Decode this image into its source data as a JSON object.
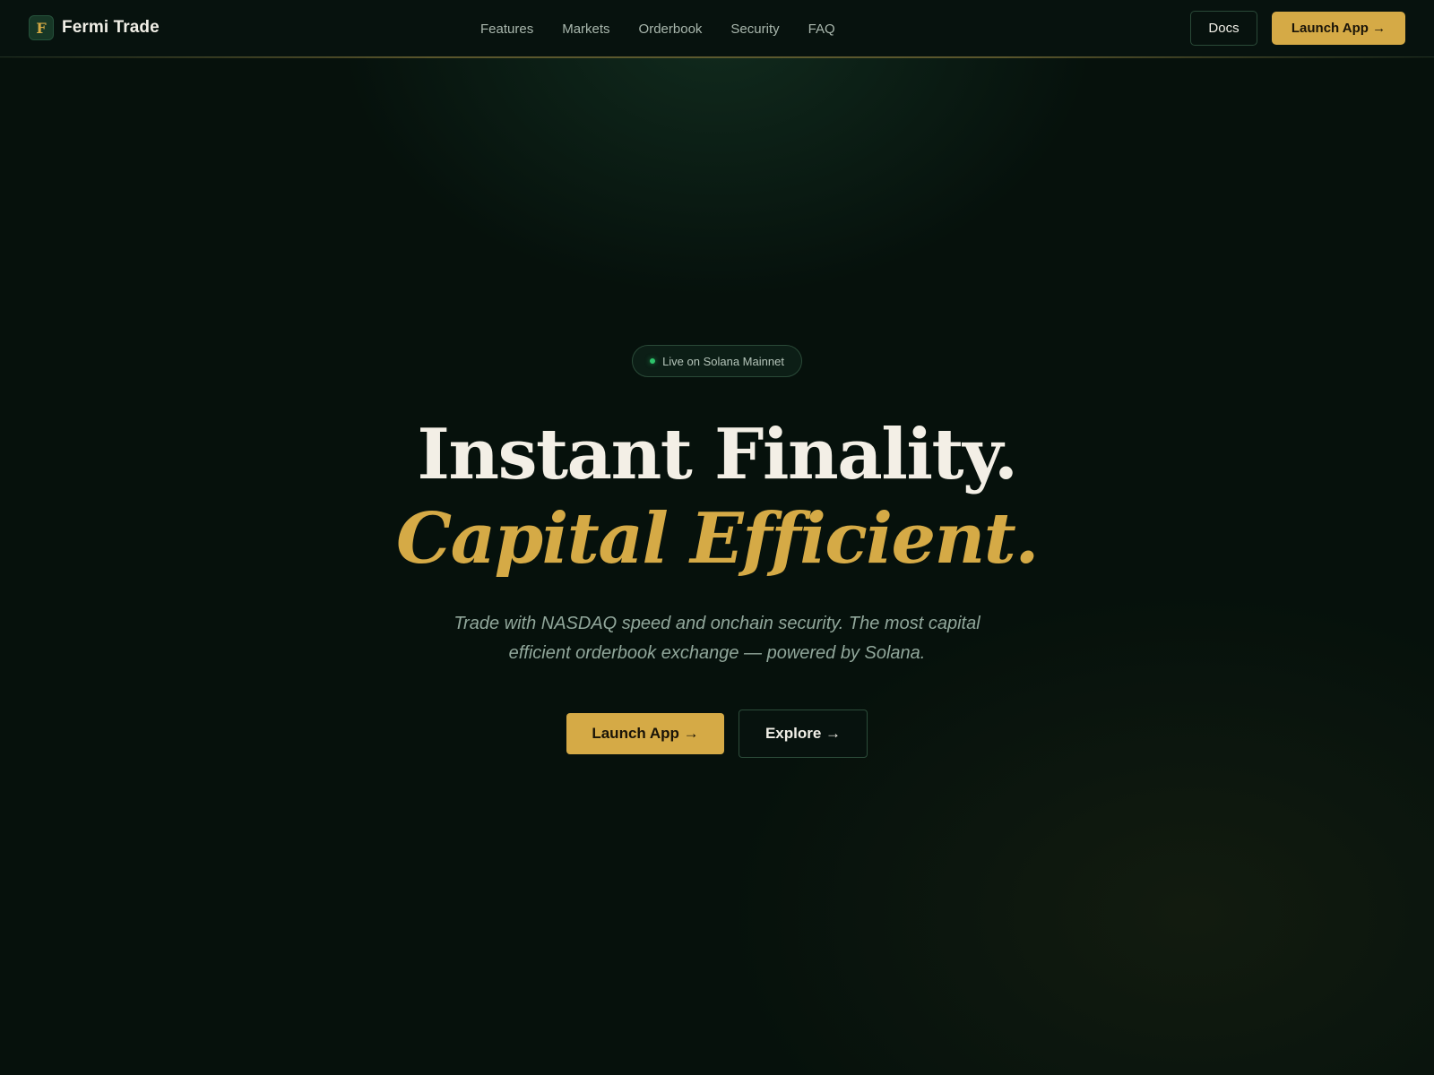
{
  "brand": {
    "logo_letter": "F",
    "name": "Fermi Trade"
  },
  "nav": {
    "links": [
      {
        "label": "Features"
      },
      {
        "label": "Markets"
      },
      {
        "label": "Orderbook"
      },
      {
        "label": "Security"
      },
      {
        "label": "FAQ"
      }
    ],
    "docs_label": "Docs",
    "launch_label": "Launch App →"
  },
  "hero": {
    "badge": "Live on Solana Mainnet",
    "headline_line1": "Instant Finality.",
    "headline_line2": "Capital Efficient.",
    "subtitle": "Trade with NASDAQ speed and onchain security. The most capital efficient orderbook exchange — powered by Solana.",
    "primary_cta": "Launch App →",
    "secondary_cta": "Explore →"
  },
  "colors": {
    "background": "#06110c",
    "accent_gold": "#d5aa46",
    "text_light": "#f3efe6",
    "status_green": "#2ec26b"
  }
}
